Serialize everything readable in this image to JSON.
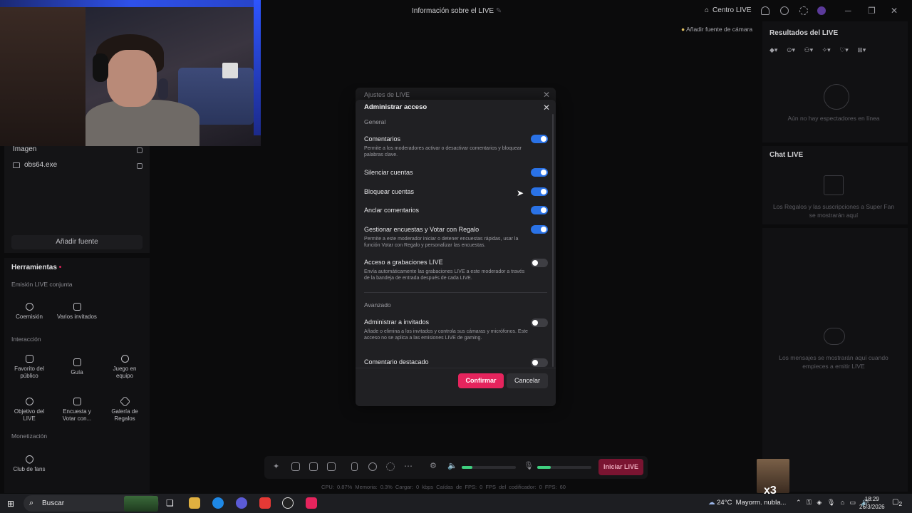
{
  "topbar": {
    "live_info": "Información sobre el LIVE",
    "centro_live": "Centro LIVE",
    "add_camera_source": "Añadir fuente de cámara"
  },
  "sources": {
    "items": [
      "Imagen",
      "obs64.exe"
    ],
    "add_source": "Añadir fuente"
  },
  "tools": {
    "title": "Herramientas",
    "sections": {
      "cohost": "Emisión LIVE conjunta",
      "interaction": "Interacción",
      "monetization": "Monetización"
    },
    "tiles": {
      "coemision": "Coemisión",
      "varios": "Varios invitados",
      "favorito": "Favorito del público",
      "guia": "Guía",
      "juego": "Juego en equipo",
      "objetivo": "Objetivo del LIVE",
      "encuesta": "Encuesta y Votar con...",
      "galeria": "Galería de Regalos",
      "club": "Club de fans"
    }
  },
  "right": {
    "results_title": "Resultados del LIVE",
    "no_viewers": "Aún no hay espectadores en línea",
    "chat_title": "Chat LIVE",
    "gifts_msg": "Los Regalos y las suscripciones a Super Fan se mostrarán aquí",
    "messages_msg": "Los mensajes se mostrarán aquí cuando empieces a emitir LIVE"
  },
  "modal": {
    "behind_title": "Ajustes de LIVE",
    "title": "Administrar acceso",
    "group_general": "General",
    "group_advanced": "Avanzado",
    "options": [
      {
        "name": "Comentarios",
        "desc": "Permite a los moderadores activar o desactivar comentarios y bloquear palabras clave.",
        "on": true
      },
      {
        "name": "Silenciar cuentas",
        "desc": "",
        "on": true
      },
      {
        "name": "Bloquear cuentas",
        "desc": "",
        "on": true
      },
      {
        "name": "Anclar comentarios",
        "desc": "",
        "on": true
      },
      {
        "name": "Gestionar encuestas y Votar con Regalo",
        "desc": "Permite a este moderador iniciar o detener encuestas rápidas, usar la función Votar con Regalo y personalizar las encuestas.",
        "on": true
      },
      {
        "name": "Acceso a grabaciones LIVE",
        "desc": "Envía automáticamente las grabaciones LIVE a este moderador a través de la bandeja de entrada después de cada LIVE.",
        "on": false
      },
      {
        "name": "Administrar a invitados",
        "desc": "Añade o elimina a los invitados y controla sus cámaras y micrófonos. Este acceso no se aplica a las emisiones LIVE de gaming.",
        "on": false
      },
      {
        "name": "Comentario destacado",
        "desc": "",
        "on": false
      }
    ],
    "confirm": "Confirmar",
    "cancel": "Cancelar"
  },
  "toolbar": {
    "start_live": "Iniciar LIVE",
    "mic_level": 0.25,
    "volume_level": 0.2
  },
  "stats": "CPU: 0.87%    Memoria: 0.3%    Cargar: 0 kbps    Caídas de FPS: 0    FPS del codificador: 0    FPS: 60",
  "taskbar": {
    "search": "Buscar",
    "temp": "24°C",
    "weather": "Mayorm. nubla...",
    "time": "18:29",
    "date": "26/3/2026",
    "notif": "2",
    "x3": "x3"
  },
  "colors": {
    "accent": "#e5245d",
    "toggle_on": "#2a72e6"
  }
}
